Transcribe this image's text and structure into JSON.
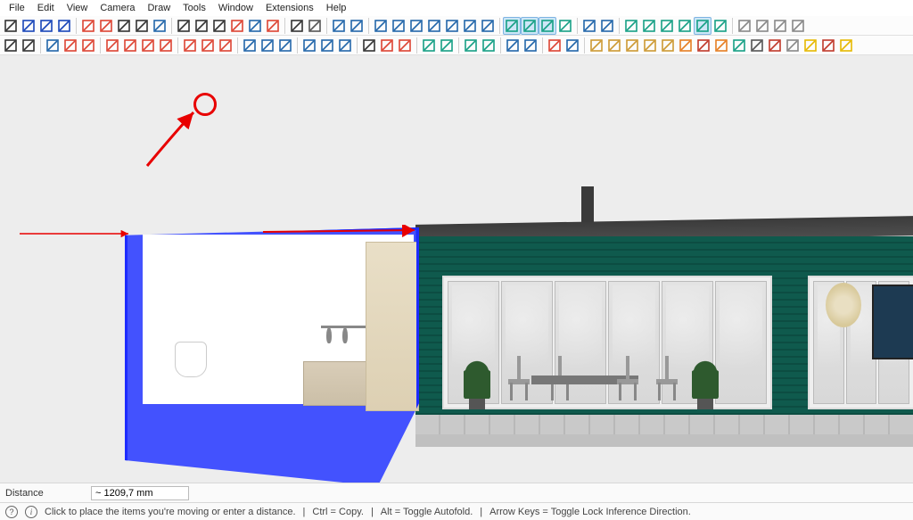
{
  "menu": {
    "items": [
      "File",
      "Edit",
      "View",
      "Camera",
      "Draw",
      "Tools",
      "Window",
      "Extensions",
      "Help"
    ]
  },
  "toolbars": {
    "row1": [
      {
        "n": "select-tool",
        "c": "#333"
      },
      {
        "n": "eraser-tool",
        "c": "#1946b9"
      },
      {
        "n": "tag-tool",
        "c": "#1946b9"
      },
      {
        "n": "crosshair-tool",
        "c": "#1946b9"
      },
      {
        "sep": true
      },
      {
        "n": "line-tool",
        "c": "#d43"
      },
      {
        "n": "offset-tool",
        "c": "#d43"
      },
      {
        "n": "tape-measure-tool",
        "c": "#333"
      },
      {
        "n": "protractor-tool",
        "c": "#333"
      },
      {
        "n": "axes-tool",
        "c": "#26a"
      },
      {
        "sep": true
      },
      {
        "n": "zoom-tool",
        "c": "#333"
      },
      {
        "n": "zoom-window-tool",
        "c": "#333"
      },
      {
        "n": "zoom-extents-tool",
        "c": "#333"
      },
      {
        "n": "pan-tool",
        "c": "#d43"
      },
      {
        "n": "orbit-tool",
        "c": "#26a"
      },
      {
        "n": "compass-tool",
        "c": "#d43"
      },
      {
        "sep": true
      },
      {
        "n": "walk-tool",
        "c": "#333"
      },
      {
        "n": "look-around-tool",
        "c": "#555"
      },
      {
        "sep": true
      },
      {
        "n": "undo-button",
        "c": "#26a"
      },
      {
        "n": "redo-button",
        "c": "#26a"
      },
      {
        "sep": true
      },
      {
        "n": "model-info-button",
        "c": "#26a"
      },
      {
        "n": "3d-warehouse-button",
        "c": "#26a"
      },
      {
        "n": "paste-button",
        "c": "#26a"
      },
      {
        "n": "cut-button",
        "c": "#26a"
      },
      {
        "n": "copy-button",
        "c": "#26a"
      },
      {
        "n": "print-button",
        "c": "#26a"
      },
      {
        "n": "new-button",
        "c": "#26a"
      },
      {
        "sep": true
      },
      {
        "n": "iso-view-button",
        "c": "#16a085",
        "active": true
      },
      {
        "n": "top-view-button",
        "c": "#16a085",
        "active": true
      },
      {
        "n": "front-view-button",
        "c": "#16a085",
        "active": true
      },
      {
        "n": "side-view-button",
        "c": "#16a085"
      },
      {
        "sep": true
      },
      {
        "n": "component-button",
        "c": "#26a"
      },
      {
        "n": "outliner-button",
        "c": "#26a"
      },
      {
        "sep": true
      },
      {
        "n": "solid-tools-1",
        "c": "#16a085"
      },
      {
        "n": "solid-tools-2",
        "c": "#16a085"
      },
      {
        "n": "solid-tools-3",
        "c": "#16a085"
      },
      {
        "n": "solid-tools-4",
        "c": "#16a085"
      },
      {
        "n": "solid-tools-5",
        "c": "#16a085",
        "active": true
      },
      {
        "n": "solid-tools-6",
        "c": "#16a085"
      },
      {
        "sep": true
      },
      {
        "n": "extension-button-1",
        "c": "#888"
      },
      {
        "n": "extension-button-2",
        "c": "#888"
      },
      {
        "n": "extension-button-3",
        "c": "#888"
      },
      {
        "n": "extension-button-4",
        "c": "#888"
      }
    ],
    "row2": [
      {
        "n": "search-tool",
        "c": "#333"
      },
      {
        "n": "arrow-tool",
        "c": "#333"
      },
      {
        "sep": true
      },
      {
        "n": "eraser-2-tool",
        "c": "#26a"
      },
      {
        "n": "pencil-tool",
        "c": "#d43"
      },
      {
        "n": "freehand-tool",
        "c": "#d43"
      },
      {
        "sep": true
      },
      {
        "n": "rectangle-tool",
        "c": "#d43"
      },
      {
        "n": "rotated-rectangle-tool",
        "c": "#d43"
      },
      {
        "n": "circle-tool",
        "c": "#d43"
      },
      {
        "n": "polygon-tool",
        "c": "#d43"
      },
      {
        "sep": true
      },
      {
        "n": "move-tool",
        "c": "#d43",
        "highlight": true
      },
      {
        "n": "rotate-tool",
        "c": "#d43"
      },
      {
        "n": "scale-tool",
        "c": "#d43"
      },
      {
        "sep": true
      },
      {
        "n": "dimension-tool",
        "c": "#26a"
      },
      {
        "n": "text-tool",
        "c": "#26a"
      },
      {
        "n": "section-plane-tool",
        "c": "#26a"
      },
      {
        "sep": true
      },
      {
        "n": "pushpull-tool",
        "c": "#26a"
      },
      {
        "n": "followme-tool",
        "c": "#26a"
      },
      {
        "n": "offset-2-tool",
        "c": "#26a"
      },
      {
        "sep": true
      },
      {
        "n": "zoom-2-tool",
        "c": "#333"
      },
      {
        "n": "orbit-2-tool",
        "c": "#d43"
      },
      {
        "n": "pan-2-tool",
        "c": "#d43"
      },
      {
        "sep": true
      },
      {
        "n": "layers-1-button",
        "c": "#16a085"
      },
      {
        "n": "layers-2-button",
        "c": "#16a085"
      },
      {
        "sep": true
      },
      {
        "n": "layers-3-button",
        "c": "#16a085"
      },
      {
        "n": "layers-4-button",
        "c": "#16a085"
      },
      {
        "sep": true
      },
      {
        "n": "report-button",
        "c": "#26a"
      },
      {
        "n": "settings-button",
        "c": "#26a"
      },
      {
        "sep": true
      },
      {
        "n": "plugin-a1",
        "c": "#d43"
      },
      {
        "n": "plugin-a2",
        "c": "#26a"
      },
      {
        "sep": true
      },
      {
        "n": "pencil-line-tool",
        "c": "#c93"
      },
      {
        "n": "ruler-tool",
        "c": "#c93"
      },
      {
        "n": "ruler-2-tool",
        "c": "#c93"
      },
      {
        "n": "paint-tool",
        "c": "#c93"
      },
      {
        "n": "paint-2-tool",
        "c": "#c93"
      },
      {
        "n": "folder-orange-button",
        "c": "#e67e22"
      },
      {
        "n": "folder-red-button",
        "c": "#c0392b"
      },
      {
        "n": "box-tool",
        "c": "#e67e22"
      },
      {
        "n": "cube-tool",
        "c": "#16a085"
      },
      {
        "n": "cube-2-tool",
        "c": "#555"
      },
      {
        "n": "pyramid-tool",
        "c": "#c0392b"
      },
      {
        "n": "scissors-tool",
        "c": "#888"
      },
      {
        "n": "curve-tool",
        "c": "#e6b800"
      },
      {
        "n": "frame-tool",
        "c": "#c0392b"
      },
      {
        "n": "frame-2-tool",
        "c": "#e6b800"
      }
    ]
  },
  "distance": {
    "label": "Distance",
    "value": "~ 1209,7 mm"
  },
  "status": {
    "hint": "Click to place the items you're moving or enter a distance.",
    "s1": "Ctrl = Copy.",
    "s2": "Alt = Toggle Autofold.",
    "s3": "Arrow Keys = Toggle Lock Inference Direction."
  }
}
